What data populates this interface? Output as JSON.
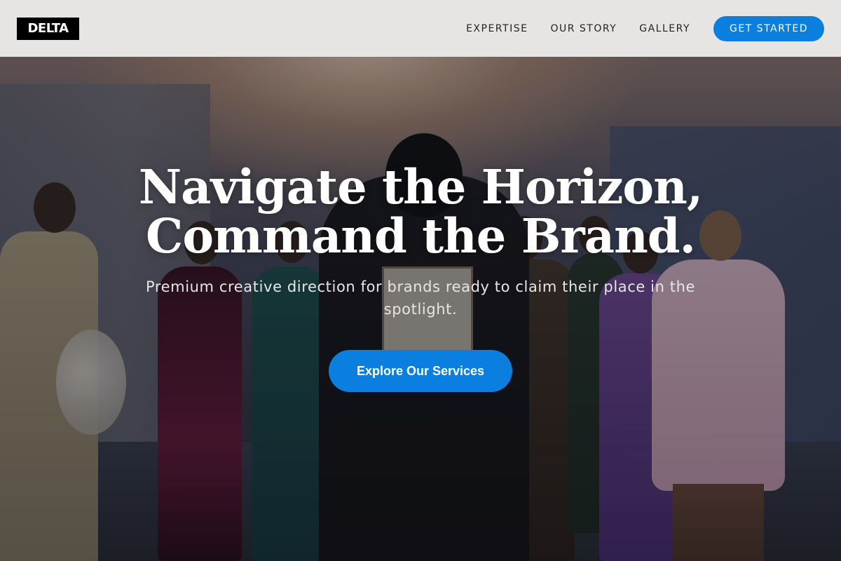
{
  "header": {
    "logo": "DELTA",
    "nav": [
      {
        "label": "EXPERTISE"
      },
      {
        "label": "OUR STORY"
      },
      {
        "label": "GALLERY"
      }
    ],
    "cta": "GET STARTED"
  },
  "hero": {
    "title_line1": "Navigate the Horizon,",
    "title_line2": "Command the Brand.",
    "subtitle": "Premium creative direction for brands ready to claim their place in the spotlight.",
    "cta": "Explore Our Services"
  },
  "colors": {
    "accent": "#0a7fdf",
    "header_bg": "#e6e5e4",
    "logo_bg": "#000000"
  }
}
